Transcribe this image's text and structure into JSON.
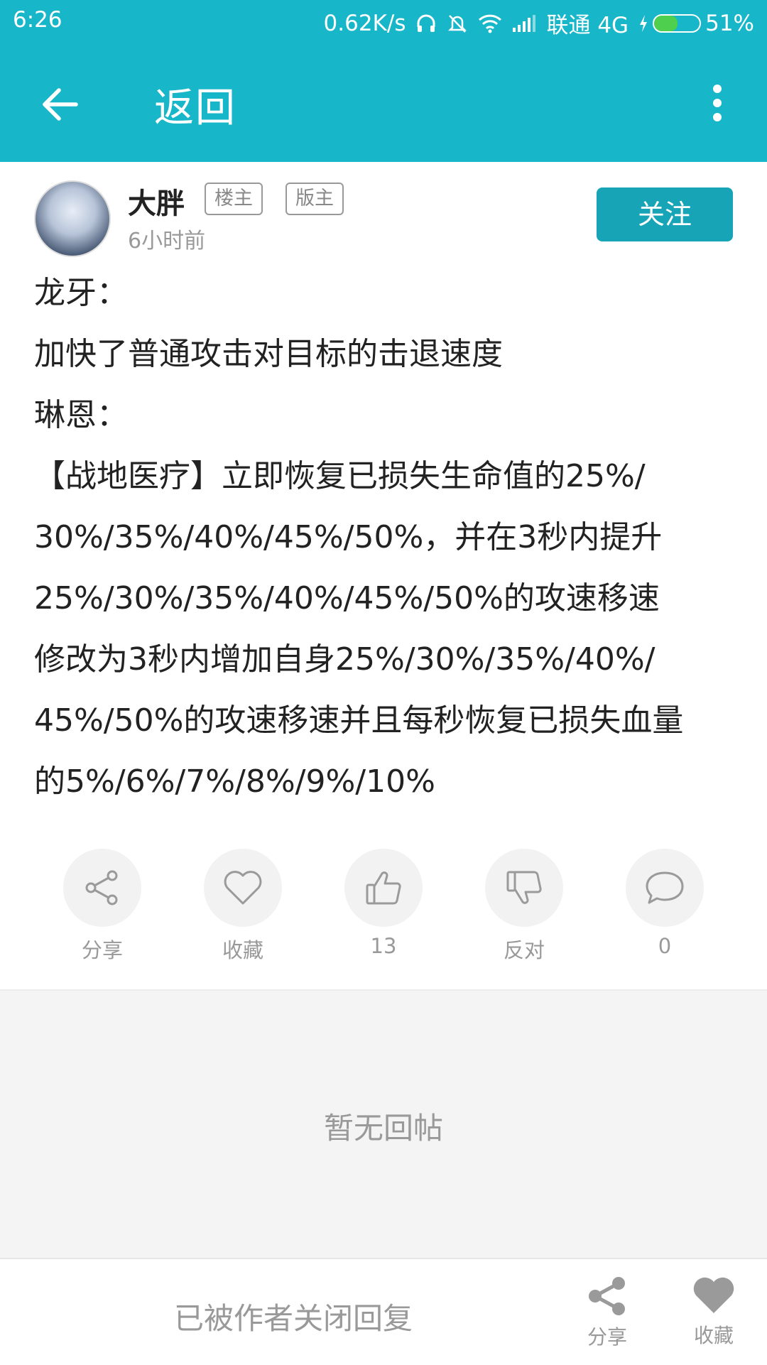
{
  "status_bar": {
    "time": "6:26",
    "net_speed": "0.62K/s",
    "carrier": "联通 4G",
    "battery": "51%",
    "battery_level": 0.51
  },
  "app_bar": {
    "title": "返回"
  },
  "post": {
    "author": "大胖",
    "badges": [
      "楼主",
      "版主"
    ],
    "time": "6小时前",
    "follow_label": "关注",
    "lines": [
      "龙牙：",
      "加快了普通攻击对目标的击退速度",
      "琳恩：",
      "【战地医疗】立即恢复已损失生命值的25%/",
      "30%/35%/40%/45%/50%，并在3秒内提升",
      "25%/30%/35%/40%/45%/50%的攻速移速",
      "修改为3秒内增加自身25%/30%/35%/40%/",
      "45%/50%的攻速移速并且每秒恢复已损失血量",
      "的5%/6%/7%/8%/9%/10%"
    ]
  },
  "actions": [
    {
      "label": "分享",
      "icon": "share-icon"
    },
    {
      "label": "收藏",
      "icon": "heart-icon"
    },
    {
      "label": "13",
      "icon": "thumbs-up-icon"
    },
    {
      "label": "反对",
      "icon": "thumbs-down-icon"
    },
    {
      "label": "0",
      "icon": "comment-icon"
    }
  ],
  "replies": {
    "empty_text": "暂无回帖"
  },
  "bottom_bar": {
    "closed_text": "已被作者关闭回复",
    "share_label": "分享",
    "favorite_label": "收藏"
  },
  "colors": {
    "primary": "#17b6c9",
    "follow_button": "#17a4b7",
    "muted_text": "#999999",
    "replies_bg": "#f4f4f4"
  }
}
